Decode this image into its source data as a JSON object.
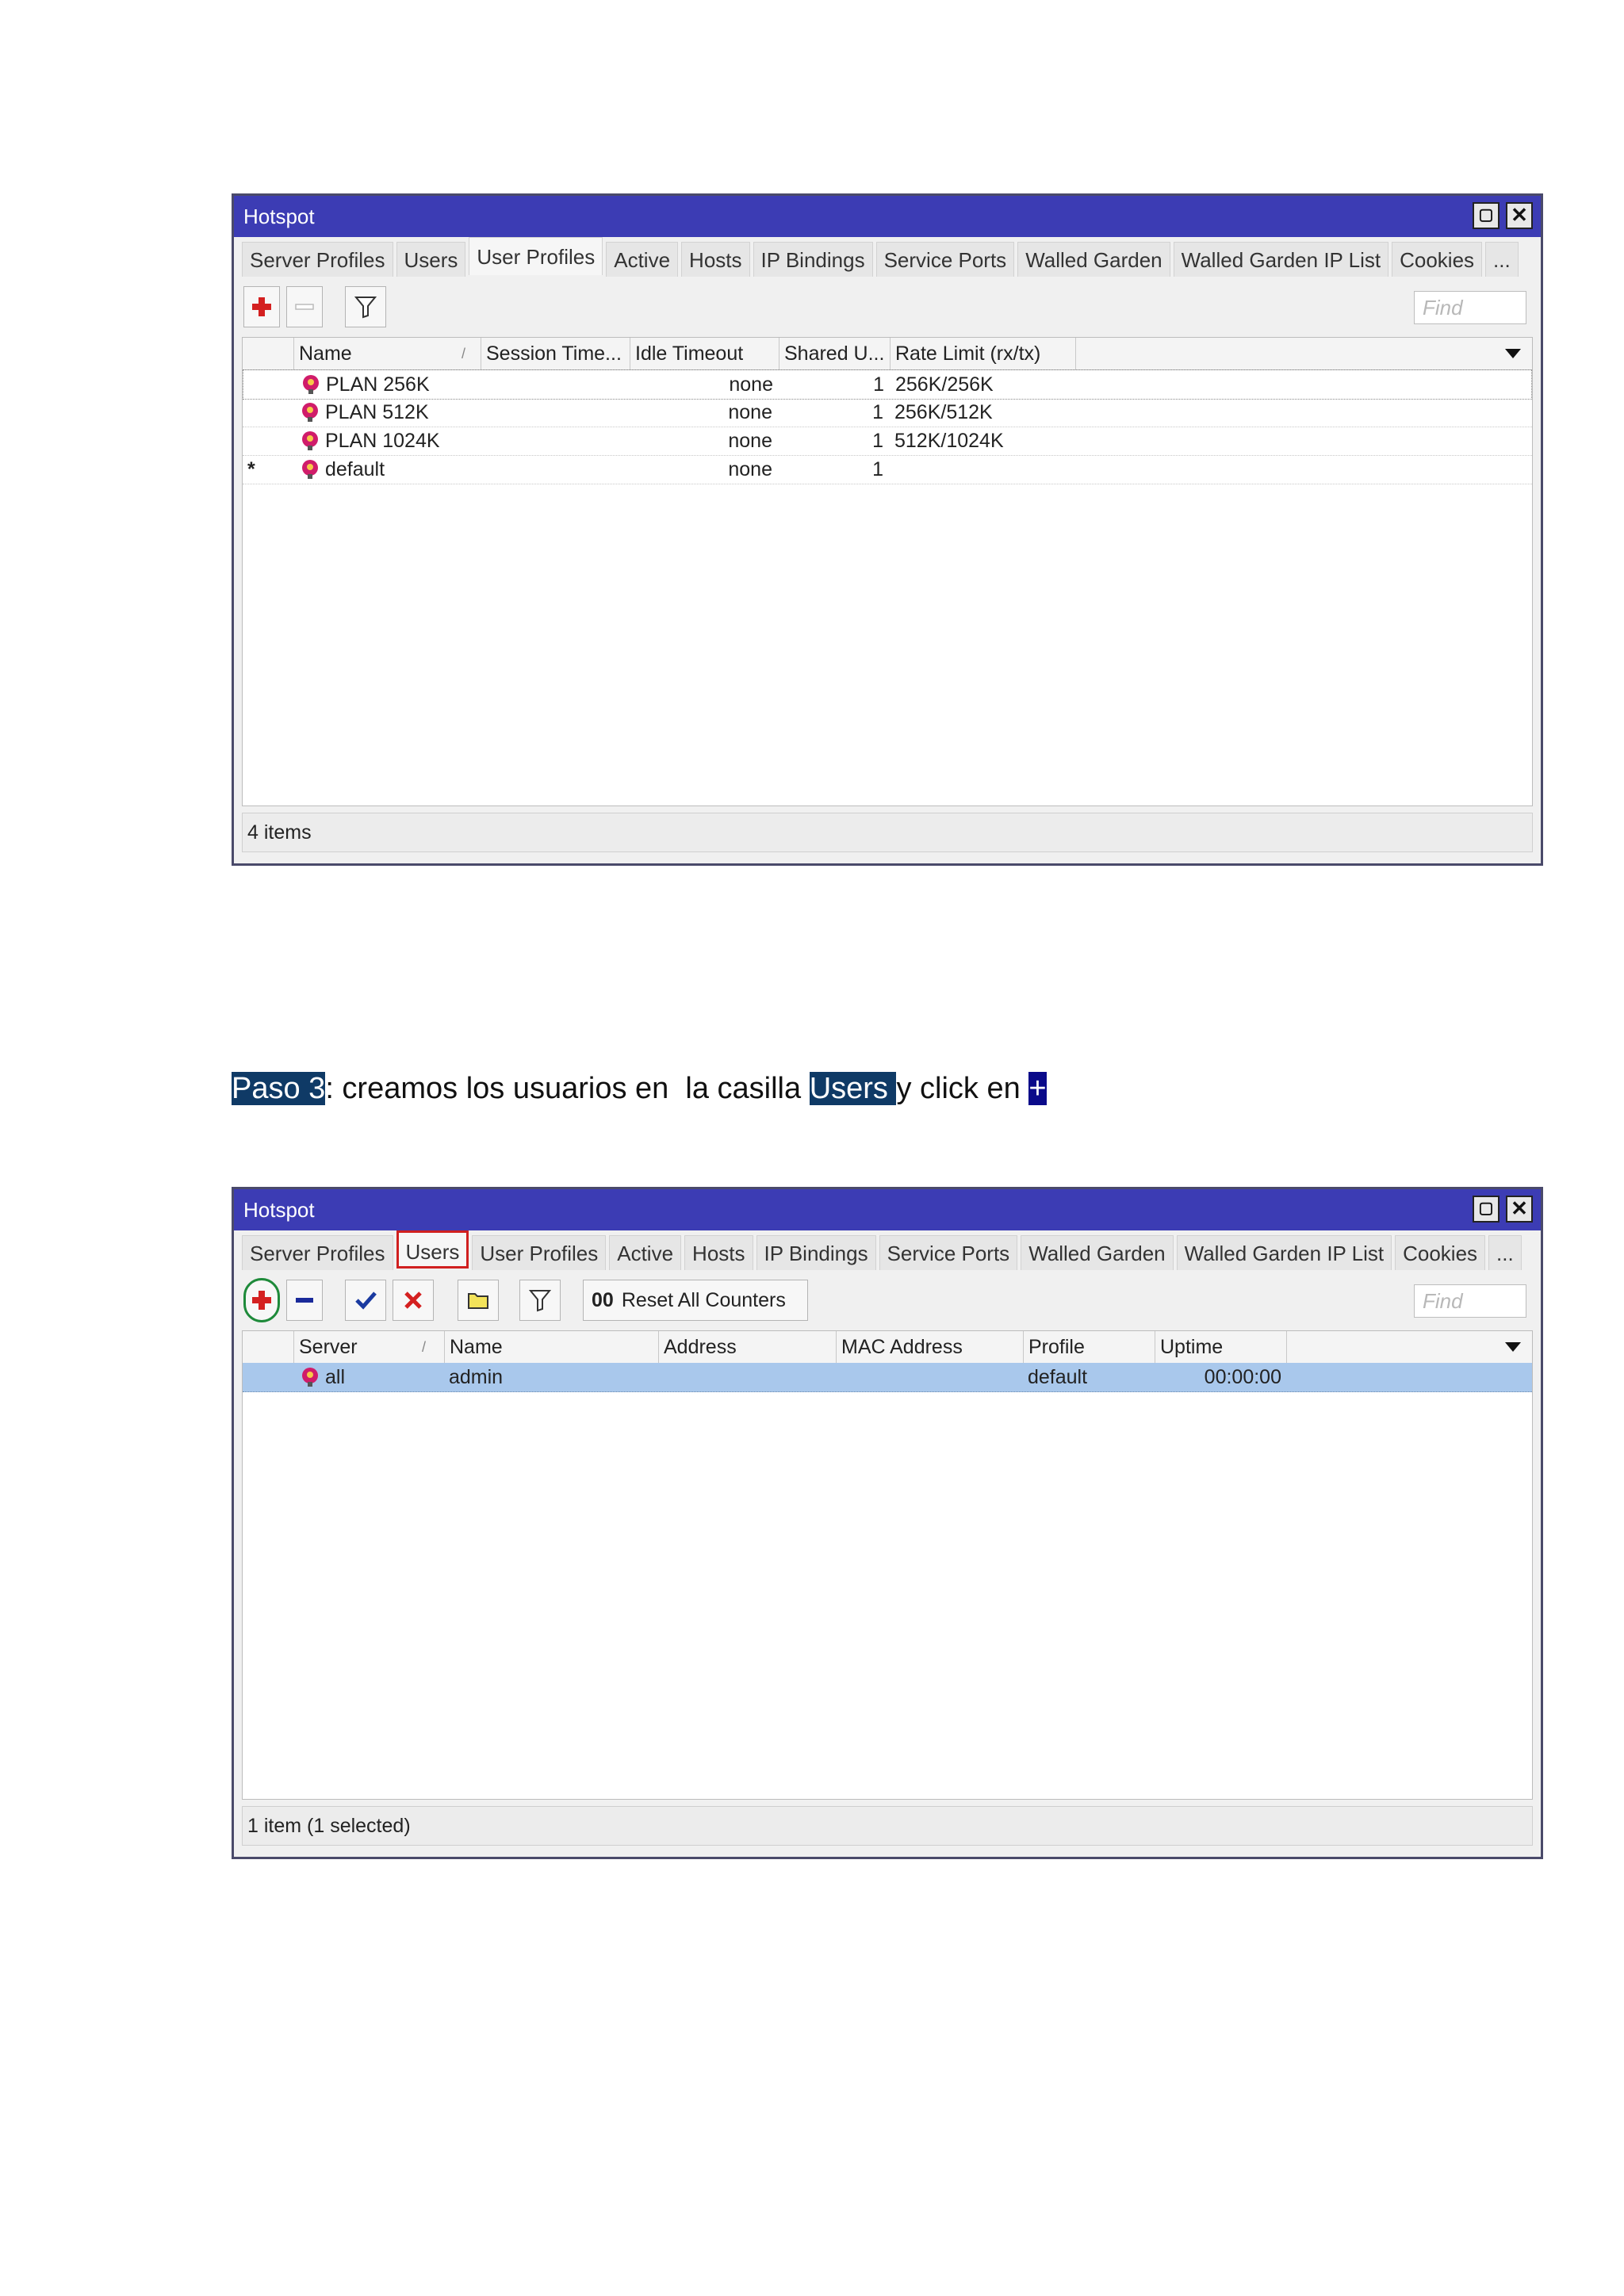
{
  "window1": {
    "title": "Hotspot",
    "tabs": [
      "Server Profiles",
      "Users",
      "User Profiles",
      "Active",
      "Hosts",
      "IP Bindings",
      "Service Ports",
      "Walled Garden",
      "Walled Garden IP List",
      "Cookies",
      "..."
    ],
    "active_tab": "User Profiles",
    "find_placeholder": "Find",
    "columns": [
      "Name",
      "Session Time...",
      "Idle Timeout",
      "Shared U...",
      "Rate Limit (rx/tx)"
    ],
    "rows": [
      {
        "name": "PLAN 256K",
        "session_time": "",
        "idle_timeout": "none",
        "shared_users": "1",
        "rate_limit": "256K/256K"
      },
      {
        "name": "PLAN 512K",
        "session_time": "",
        "idle_timeout": "none",
        "shared_users": "1",
        "rate_limit": "256K/512K"
      },
      {
        "name": "PLAN 1024K",
        "session_time": "",
        "idle_timeout": "none",
        "shared_users": "1",
        "rate_limit": "512K/1024K"
      },
      {
        "marker": "*",
        "name": "default",
        "session_time": "",
        "idle_timeout": "none",
        "shared_users": "1",
        "rate_limit": ""
      }
    ],
    "status": "4 items"
  },
  "step_text": {
    "step_label": "Paso 3",
    "part1": ": creamos los usuarios en  la casilla ",
    "users_label": "Users ",
    "part2": "y click en ",
    "plus_label": "+"
  },
  "window2": {
    "title": "Hotspot",
    "tabs": [
      "Server Profiles",
      "Users",
      "User Profiles",
      "Active",
      "Hosts",
      "IP Bindings",
      "Service Ports",
      "Walled Garden",
      "Walled Garden IP List",
      "Cookies",
      "..."
    ],
    "active_tab": "Users",
    "reset_counters_label": "Reset All Counters",
    "reset_counters_prefix": "00",
    "find_placeholder": "Find",
    "columns": [
      "Server",
      "Name",
      "Address",
      "MAC Address",
      "Profile",
      "Uptime"
    ],
    "rows": [
      {
        "server": "all",
        "name": "admin",
        "address": "",
        "mac": "",
        "profile": "default",
        "uptime": "00:00:00"
      }
    ],
    "status": "1 item (1 selected)"
  },
  "colors": {
    "titlebar": "#3c3cb4",
    "highlight_callout": "#d02020",
    "add_button_circle": "#1e8a3a",
    "selected_row": "#a9c8ec",
    "step_highlight": "#0f3a66"
  }
}
